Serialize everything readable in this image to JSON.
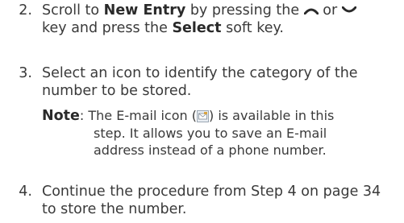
{
  "step2": {
    "number": "2.",
    "text_a": "Scroll to ",
    "bold_a": "New Entry",
    "text_b": " by pressing the ",
    "text_c": " or ",
    "text_d": "key and press the ",
    "bold_b": "Select",
    "text_e": " soft key.",
    "icons": [
      "up-arrow-icon",
      "down-arrow-icon"
    ]
  },
  "step3": {
    "number": "3.",
    "line1": "Select an icon to identify the category of the",
    "line2": "number to be stored.",
    "note": {
      "label": "Note",
      "text_a": ": The E-mail icon (",
      "text_b": ") is available in this",
      "line2": "step. It allows you to save an E-mail",
      "line3": "address instead of a phone number.",
      "icon": "email-icon"
    }
  },
  "step4": {
    "number": "4.",
    "line1": "Continue the procedure from Step 4 on page 34",
    "line2": "to store the number."
  }
}
